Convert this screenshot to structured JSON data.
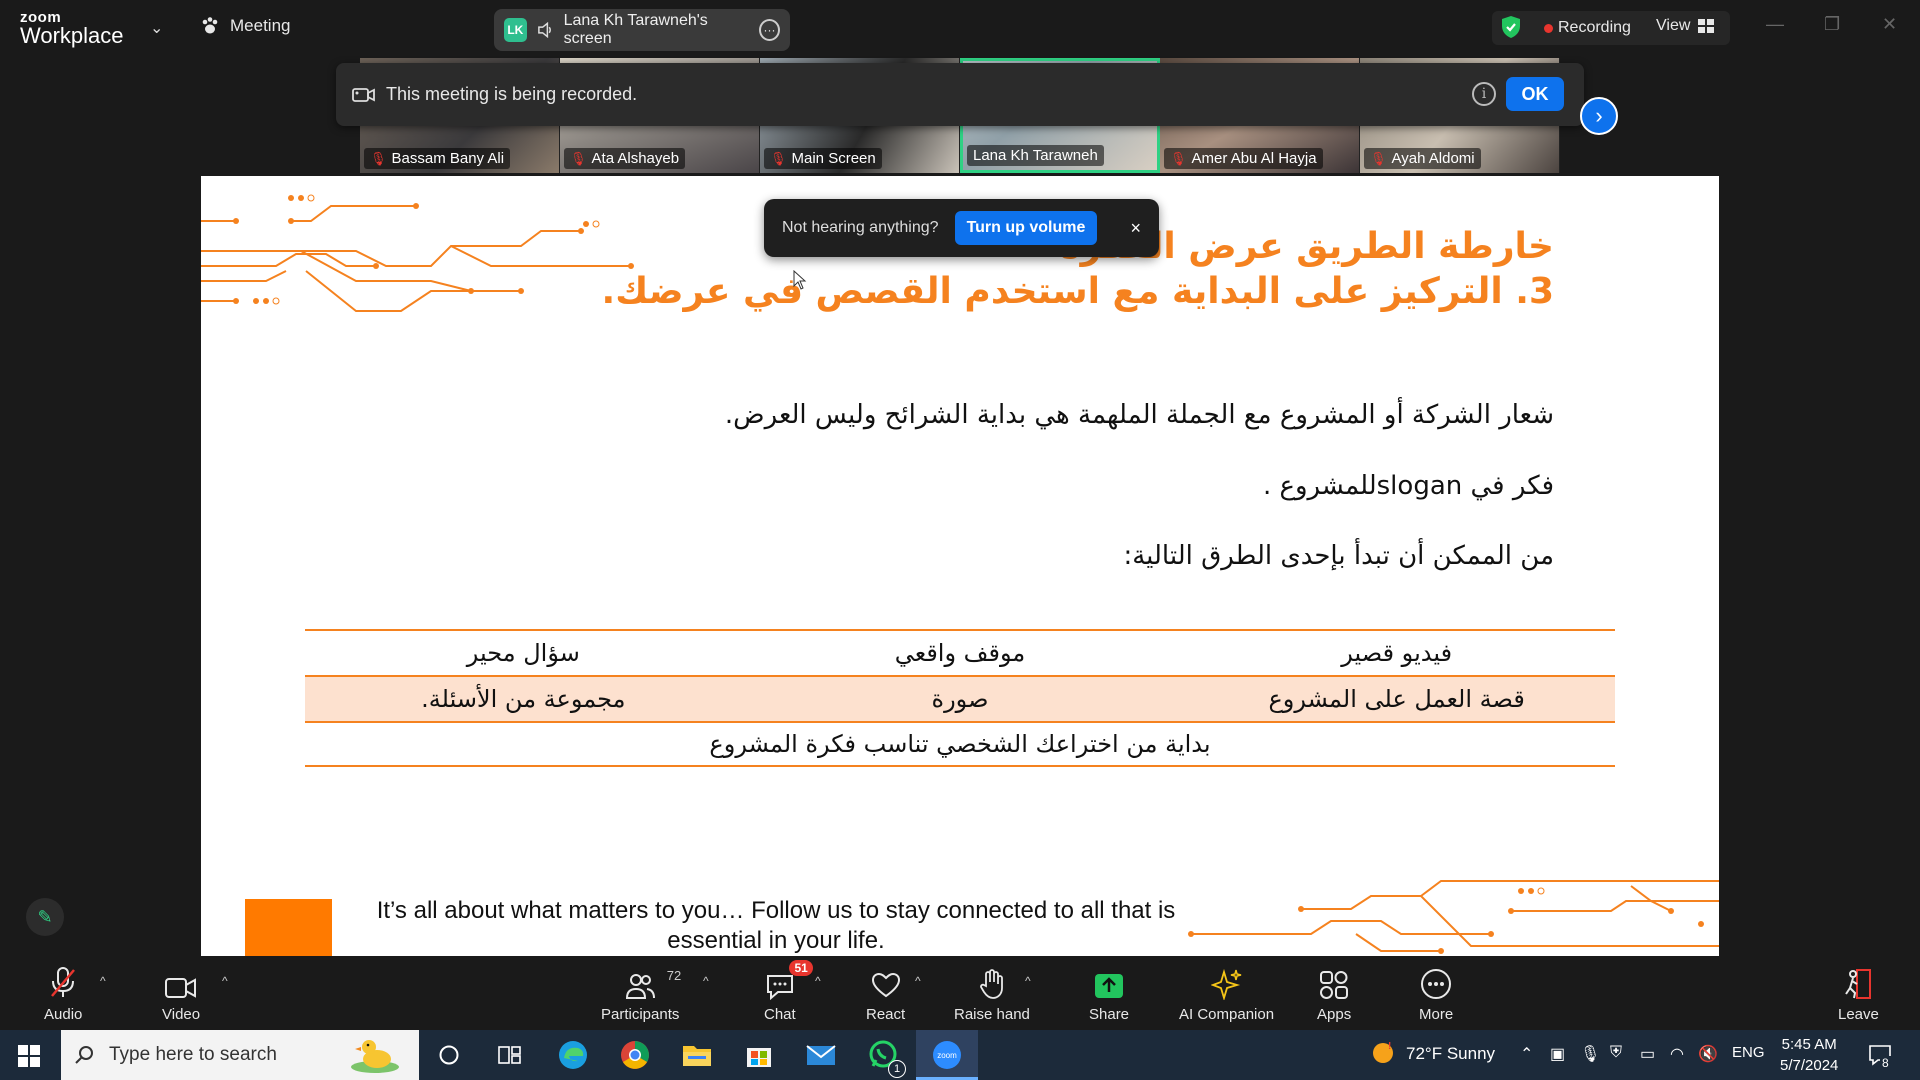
{
  "app": {
    "logo_top": "zoom",
    "logo_bottom": "Workplace",
    "meeting_menu": "Meeting",
    "share_initials": "LK",
    "share_label": "Lana Kh Tarawneh's screen",
    "recording_label": "Recording",
    "view_label": "View"
  },
  "participants_strip": [
    {
      "name": "Bassam Bany Ali"
    },
    {
      "name": "Ata Alshayeb"
    },
    {
      "name": "Main Screen"
    },
    {
      "name": "Lana Kh Tarawneh"
    },
    {
      "name": "Amer Abu Al Hayja"
    },
    {
      "name": "Ayah Aldomi"
    }
  ],
  "banner": {
    "text": "This meeting is being recorded.",
    "info": "i",
    "ok": "OK"
  },
  "toast": {
    "text": "Not hearing anything?",
    "button": "Turn up volume",
    "close": "×"
  },
  "slide": {
    "title1": "خارطة الطريق عرض الفكرة",
    "title2": "3. التركيز على البداية مع استخدم القصص في عرضك.",
    "line1": "شعار الشركة أو المشروع مع الجملة الملهمة هي بداية الشرائح وليس العرض.",
    "line2": "فكر في  sloganللمشروع .",
    "line3": "من الممكن أن تبدأ بإحدى الطرق التالية:",
    "table": {
      "row1": [
        "فيديو قصير",
        "موقف واقعي",
        "سؤال محير"
      ],
      "row2": [
        "قصة العمل على المشروع",
        "صورة",
        "مجموعة من الأسئلة."
      ],
      "row3": "بداية من اختراعك الشخصي تناسب فكرة المشروع"
    },
    "footer": "It’s all about what matters to you… Follow us to stay connected to all that is essential in your life."
  },
  "toolbar": {
    "audio": "Audio",
    "video": "Video",
    "participants": "Participants",
    "participants_count": "72",
    "chat": "Chat",
    "chat_badge": "51",
    "react": "React",
    "raise_hand": "Raise hand",
    "share": "Share",
    "ai_companion": "AI Companion",
    "apps": "Apps",
    "more": "More",
    "leave": "Leave"
  },
  "taskbar": {
    "search_placeholder": "Type here to search",
    "weather": "72°F  Sunny",
    "lang": "ENG",
    "time": "5:45 AM",
    "date": "5/7/2024",
    "notif_count": "8",
    "whatsapp_badge": "1"
  },
  "colors": {
    "accent_orange": "#f5821f",
    "zoom_blue": "#0e72ed",
    "active_green": "#2fd184",
    "record_red": "#e8352e"
  }
}
